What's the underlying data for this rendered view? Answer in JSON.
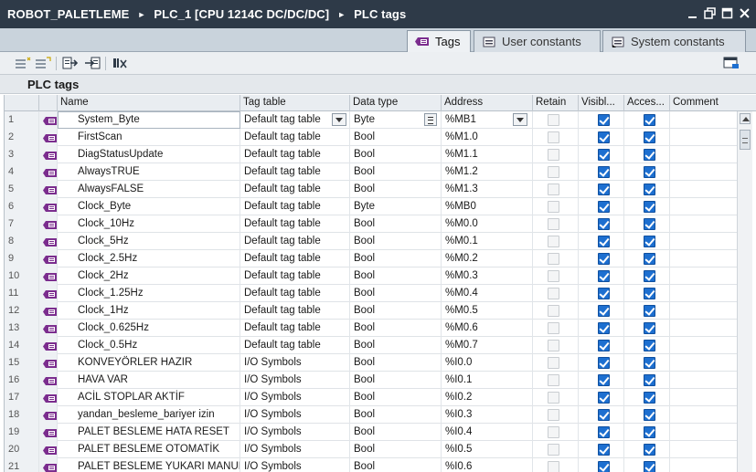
{
  "breadcrumb": {
    "items": [
      "ROBOT_PALETLEME",
      "PLC_1 [CPU 1214C DC/DC/DC]",
      "PLC tags"
    ],
    "separator": "►"
  },
  "window_controls": [
    "minimize-icon",
    "restore-icon",
    "maximize-icon",
    "close-icon"
  ],
  "tabs": [
    {
      "label": "Tags",
      "icon": "tag-table-icon",
      "active": true
    },
    {
      "label": "User constants",
      "icon": "constants-icon",
      "active": false
    },
    {
      "label": "System constants",
      "icon": "system-constants-icon",
      "active": false
    }
  ],
  "toolbar": {
    "buttons": [
      "add-row-icon",
      "insert-row-icon",
      "export-icon",
      "import-icon",
      "monitor-icon",
      "settings-icon"
    ]
  },
  "section": {
    "title": "PLC tags"
  },
  "table": {
    "columns": [
      "Name",
      "Tag table",
      "Data type",
      "Address",
      "Retain",
      "Visibl...",
      "Acces...",
      "Comment"
    ],
    "rows": [
      {
        "n": "1",
        "name": "System_Byte",
        "tagtable": "Default tag table",
        "type": "Byte",
        "addr": "%MB1",
        "retain_enabled": false,
        "visible": true,
        "access": true,
        "editing": true
      },
      {
        "n": "2",
        "name": "FirstScan",
        "tagtable": "Default tag table",
        "type": "Bool",
        "addr": "%M1.0",
        "retain_enabled": false,
        "visible": true,
        "access": true
      },
      {
        "n": "3",
        "name": "DiagStatusUpdate",
        "tagtable": "Default tag table",
        "type": "Bool",
        "addr": "%M1.1",
        "retain_enabled": false,
        "visible": true,
        "access": true
      },
      {
        "n": "4",
        "name": "AlwaysTRUE",
        "tagtable": "Default tag table",
        "type": "Bool",
        "addr": "%M1.2",
        "retain_enabled": false,
        "visible": true,
        "access": true
      },
      {
        "n": "5",
        "name": "AlwaysFALSE",
        "tagtable": "Default tag table",
        "type": "Bool",
        "addr": "%M1.3",
        "retain_enabled": false,
        "visible": true,
        "access": true
      },
      {
        "n": "6",
        "name": "Clock_Byte",
        "tagtable": "Default tag table",
        "type": "Byte",
        "addr": "%MB0",
        "retain_enabled": false,
        "visible": true,
        "access": true
      },
      {
        "n": "7",
        "name": "Clock_10Hz",
        "tagtable": "Default tag table",
        "type": "Bool",
        "addr": "%M0.0",
        "retain_enabled": false,
        "visible": true,
        "access": true
      },
      {
        "n": "8",
        "name": "Clock_5Hz",
        "tagtable": "Default tag table",
        "type": "Bool",
        "addr": "%M0.1",
        "retain_enabled": false,
        "visible": true,
        "access": true
      },
      {
        "n": "9",
        "name": "Clock_2.5Hz",
        "tagtable": "Default tag table",
        "type": "Bool",
        "addr": "%M0.2",
        "retain_enabled": false,
        "visible": true,
        "access": true
      },
      {
        "n": "10",
        "name": "Clock_2Hz",
        "tagtable": "Default tag table",
        "type": "Bool",
        "addr": "%M0.3",
        "retain_enabled": false,
        "visible": true,
        "access": true
      },
      {
        "n": "11",
        "name": "Clock_1.25Hz",
        "tagtable": "Default tag table",
        "type": "Bool",
        "addr": "%M0.4",
        "retain_enabled": false,
        "visible": true,
        "access": true
      },
      {
        "n": "12",
        "name": "Clock_1Hz",
        "tagtable": "Default tag table",
        "type": "Bool",
        "addr": "%M0.5",
        "retain_enabled": false,
        "visible": true,
        "access": true
      },
      {
        "n": "13",
        "name": "Clock_0.625Hz",
        "tagtable": "Default tag table",
        "type": "Bool",
        "addr": "%M0.6",
        "retain_enabled": false,
        "visible": true,
        "access": true
      },
      {
        "n": "14",
        "name": "Clock_0.5Hz",
        "tagtable": "Default tag table",
        "type": "Bool",
        "addr": "%M0.7",
        "retain_enabled": false,
        "visible": true,
        "access": true
      },
      {
        "n": "15",
        "name": "KONVEYÖRLER HAZIR",
        "tagtable": "I/O Symbols",
        "type": "Bool",
        "addr": "%I0.0",
        "retain_enabled": false,
        "visible": true,
        "access": true
      },
      {
        "n": "16",
        "name": "HAVA VAR",
        "tagtable": "I/O Symbols",
        "type": "Bool",
        "addr": "%I0.1",
        "retain_enabled": false,
        "visible": true,
        "access": true
      },
      {
        "n": "17",
        "name": "ACİL STOPLAR AKTİF",
        "tagtable": "I/O Symbols",
        "type": "Bool",
        "addr": "%I0.2",
        "retain_enabled": false,
        "visible": true,
        "access": true
      },
      {
        "n": "18",
        "name": "yandan_besleme_bariyer izin",
        "tagtable": "I/O Symbols",
        "type": "Bool",
        "addr": "%I0.3",
        "retain_enabled": false,
        "visible": true,
        "access": true
      },
      {
        "n": "19",
        "name": "PALET BESLEME HATA RESET",
        "tagtable": "I/O Symbols",
        "type": "Bool",
        "addr": "%I0.4",
        "retain_enabled": false,
        "visible": true,
        "access": true
      },
      {
        "n": "20",
        "name": "PALET BESLEME OTOMATİK",
        "tagtable": "I/O Symbols",
        "type": "Bool",
        "addr": "%I0.5",
        "retain_enabled": false,
        "visible": true,
        "access": true
      },
      {
        "n": "21",
        "name": "PALET BESLEME YUKARI MANUEL",
        "tagtable": "I/O Symbols",
        "type": "Bool",
        "addr": "%I0.6",
        "retain_enabled": false,
        "visible": true,
        "access": true
      }
    ]
  },
  "colors": {
    "titlebar": "#2e3a48",
    "checkbox_on": "#1d6fd0",
    "tag_icon": "#7b2d8e"
  }
}
